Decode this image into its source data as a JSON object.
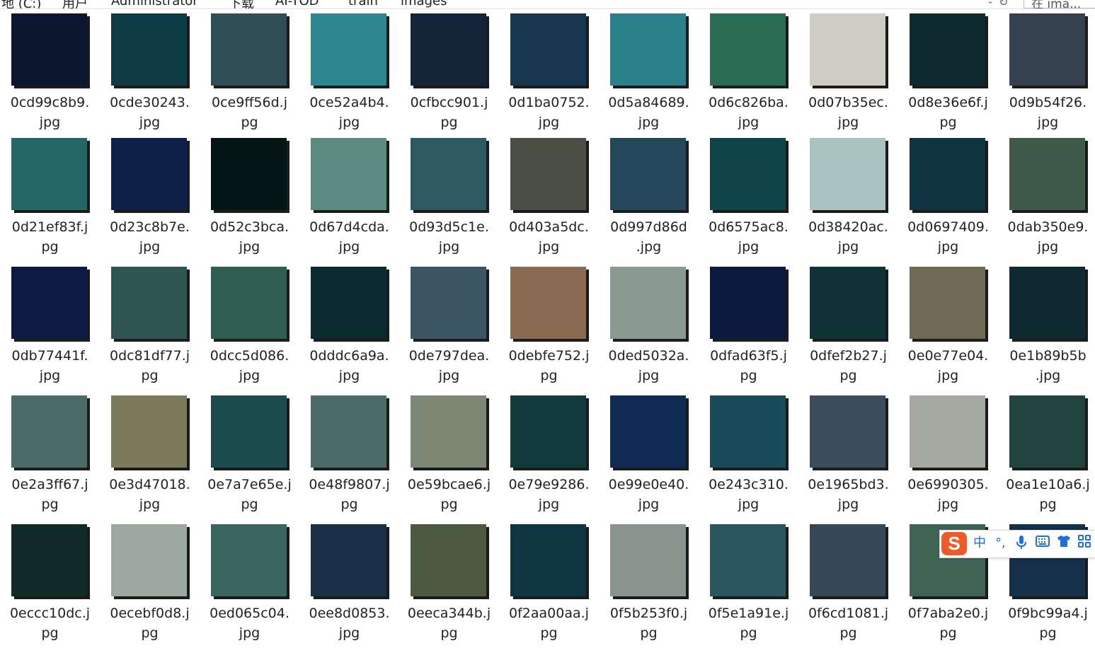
{
  "address_bar": {
    "breadcrumbs": [
      "地 (C:)",
      "用户",
      "Administrator",
      "下载",
      "AI-TOD",
      "train",
      "images"
    ],
    "separator": "›",
    "search_placeholder": "在 ima..."
  },
  "files": [
    {
      "name": "0cd99c8b9.jpg",
      "l1": "0cd99c8b9.",
      "l2": "jpg",
      "color": "#0d1730"
    },
    {
      "name": "0cde30243.jpg",
      "l1": "0cde30243.",
      "l2": "jpg",
      "color": "#0e3a45"
    },
    {
      "name": "0ce9ff56d.jpg",
      "l1": "0ce9ff56d.j",
      "l2": "pg",
      "color": "#2e4e55"
    },
    {
      "name": "0ce52a4b4.jpg",
      "l1": "0ce52a4b4.",
      "l2": "jpg",
      "color": "#2c8790"
    },
    {
      "name": "0cfbcc901.jpg",
      "l1": "0cfbcc901.j",
      "l2": "pg",
      "color": "#132438"
    },
    {
      "name": "0d1ba0752.jpg",
      "l1": "0d1ba0752.",
      "l2": "jpg",
      "color": "#173750"
    },
    {
      "name": "0d5a84689.jpg",
      "l1": "0d5a84689.",
      "l2": "jpg",
      "color": "#2a7f8a"
    },
    {
      "name": "0d6c826ba.jpg",
      "l1": "0d6c826ba.",
      "l2": "jpg",
      "color": "#2a6d55"
    },
    {
      "name": "0d07b35ec.jpg",
      "l1": "0d07b35ec.",
      "l2": "jpg",
      "color": "#cfcdc3"
    },
    {
      "name": "0d8e36e6f.jpg",
      "l1": "0d8e36e6f.j",
      "l2": "pg",
      "color": "#0e2a2f"
    },
    {
      "name": "0d9b54f26.jpg",
      "l1": "0d9b54f26.",
      "l2": "jpg",
      "color": "#35414e"
    },
    {
      "name": "0d21ef83f.jpg",
      "l1": "0d21ef83f.j",
      "l2": "pg",
      "color": "#236663"
    },
    {
      "name": "0d23c8b7e.jpg",
      "l1": "0d23c8b7e.",
      "l2": "jpg",
      "color": "#0d2048"
    },
    {
      "name": "0d52c3bca.jpg",
      "l1": "0d52c3bca.",
      "l2": "jpg",
      "color": "#051515"
    },
    {
      "name": "0d67d4cda.jpg",
      "l1": "0d67d4cda.",
      "l2": "jpg",
      "color": "#5d8a80"
    },
    {
      "name": "0d93d5c1e.jpg",
      "l1": "0d93d5c1e.",
      "l2": "jpg",
      "color": "#2d5a60"
    },
    {
      "name": "0d403a5dc.jpg",
      "l1": "0d403a5dc.",
      "l2": "jpg",
      "color": "#4a4e45"
    },
    {
      "name": "0d997d86d.jpg",
      "l1": "0d997d86d",
      "l2": ".jpg",
      "color": "#24475a"
    },
    {
      "name": "0d6575ac8.jpg",
      "l1": "0d6575ac8.",
      "l2": "jpg",
      "color": "#0f4448"
    },
    {
      "name": "0d38420ac.jpg",
      "l1": "0d38420ac.",
      "l2": "jpg",
      "color": "#a9c4c0"
    },
    {
      "name": "0d0697409.jpg",
      "l1": "0d0697409.",
      "l2": "jpg",
      "color": "#0d3440"
    },
    {
      "name": "0dab350e9.jpg",
      "l1": "0dab350e9.",
      "l2": "jpg",
      "color": "#3f5a48"
    },
    {
      "name": "0db77441f.jpg",
      "l1": "0db77441f.",
      "l2": "jpg",
      "color": "#0d1a42"
    },
    {
      "name": "0dc81df77.jpg",
      "l1": "0dc81df77.j",
      "l2": "pg",
      "color": "#2e5552"
    },
    {
      "name": "0dcc5d086.jpg",
      "l1": "0dcc5d086.",
      "l2": "jpg",
      "color": "#2f5d4f"
    },
    {
      "name": "0dddc6a9a.jpg",
      "l1": "0dddc6a9a.",
      "l2": "jpg",
      "color": "#0b2a30"
    },
    {
      "name": "0de797dea.jpg",
      "l1": "0de797dea.",
      "l2": "jpg",
      "color": "#3b5562"
    },
    {
      "name": "0debfe752.jpg",
      "l1": "0debfe752.j",
      "l2": "pg",
      "color": "#8a6a50"
    },
    {
      "name": "0ded5032a.jpg",
      "l1": "0ded5032a.",
      "l2": "jpg",
      "color": "#8a9a90"
    },
    {
      "name": "0dfad63f5.jpg",
      "l1": "0dfad63f5.j",
      "l2": "pg",
      "color": "#0c1a40"
    },
    {
      "name": "0dfef2b27.jpg",
      "l1": "0dfef2b27.j",
      "l2": "pg",
      "color": "#0e3235"
    },
    {
      "name": "0e0e77e04.jpg",
      "l1": "0e0e77e04.",
      "l2": "jpg",
      "color": "#6f6a55"
    },
    {
      "name": "0e1b89b5b.jpg",
      "l1": "0e1b89b5b",
      "l2": ".jpg",
      "color": "#0e2a30"
    },
    {
      "name": "0e2a3ff67.jpg",
      "l1": "0e2a3ff67.j",
      "l2": "pg",
      "color": "#4c6a66"
    },
    {
      "name": "0e3d47018.jpg",
      "l1": "0e3d47018.",
      "l2": "jpg",
      "color": "#7b7a5a"
    },
    {
      "name": "0e7a7e65e.jpg",
      "l1": "0e7a7e65e.j",
      "l2": "pg",
      "color": "#1d4c4e"
    },
    {
      "name": "0e48f9807.jpg",
      "l1": "0e48f9807.j",
      "l2": "pg",
      "color": "#4d6a6a"
    },
    {
      "name": "0e59bcae6.jpg",
      "l1": "0e59bcae6.j",
      "l2": "pg",
      "color": "#7c8774"
    },
    {
      "name": "0e79e9286.jpg",
      "l1": "0e79e9286.",
      "l2": "jpg",
      "color": "#103a3c"
    },
    {
      "name": "0e99e0e40.jpg",
      "l1": "0e99e0e40.",
      "l2": "jpg",
      "color": "#0f2a50"
    },
    {
      "name": "0e243c310.jpg",
      "l1": "0e243c310.",
      "l2": "jpg",
      "color": "#194a58"
    },
    {
      "name": "0e1965bd3.jpg",
      "l1": "0e1965bd3.",
      "l2": "jpg",
      "color": "#3b4d5a"
    },
    {
      "name": "0e6990305.jpg",
      "l1": "0e6990305.",
      "l2": "jpg",
      "color": "#a6a9a2"
    },
    {
      "name": "0ea1e10a6.jpg",
      "l1": "0ea1e10a6.j",
      "l2": "pg",
      "color": "#22443f"
    },
    {
      "name": "0eccc10dc.jpg",
      "l1": "0eccc10dc.j",
      "l2": "pg",
      "color": "#102b27"
    },
    {
      "name": "0ecebf0d8.jpg",
      "l1": "0ecebf0d8.j",
      "l2": "pg",
      "color": "#9aa8a0"
    },
    {
      "name": "0ed065c04.jpg",
      "l1": "0ed065c04.",
      "l2": "jpg",
      "color": "#3b6660"
    },
    {
      "name": "0ee8d0853.jpg",
      "l1": "0ee8d0853.",
      "l2": "jpg",
      "color": "#1a2e46"
    },
    {
      "name": "0eeca344b.jpg",
      "l1": "0eeca344b.j",
      "l2": "pg",
      "color": "#4d5a40"
    },
    {
      "name": "0f2aa00aa.jpg",
      "l1": "0f2aa00aa.j",
      "l2": "pg",
      "color": "#0e3542"
    },
    {
      "name": "0f5b253f0.jpg",
      "l1": "0f5b253f0.j",
      "l2": "pg",
      "color": "#8a948f"
    },
    {
      "name": "0f5e1a91e.jpg",
      "l1": "0f5e1a91e.j",
      "l2": "pg",
      "color": "#2b5660"
    },
    {
      "name": "0f6cd1081.jpg",
      "l1": "0f6cd1081.j",
      "l2": "pg",
      "color": "#364856"
    },
    {
      "name": "0f7aba2e0.jpg",
      "l1": "0f7aba2e0.j",
      "l2": "pg",
      "color": "#3f6456"
    },
    {
      "name": "0f9bc99a4.jpg",
      "l1": "0f9bc99a4.j",
      "l2": "pg",
      "color": "#14304a"
    }
  ],
  "ime": {
    "logo": "S",
    "lang": "中",
    "punct": "°,",
    "voice_icon": "microphone-icon",
    "keyboard_icon": "keyboard-icon",
    "skin_icon": "shirt-icon",
    "tools_icon": "grid-icon",
    "accent": "#f05a28"
  }
}
